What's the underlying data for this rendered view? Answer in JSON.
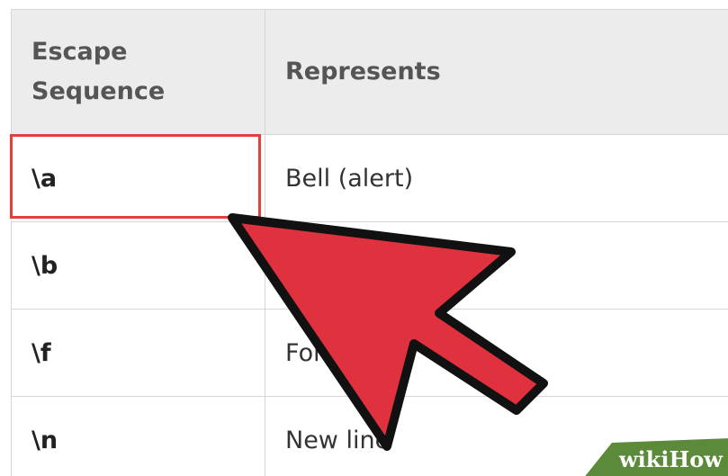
{
  "table": {
    "headers": [
      "Escape Sequence",
      "Represents"
    ],
    "rows": [
      {
        "sequence": "\\a",
        "represents": "Bell (alert)"
      },
      {
        "sequence": "\\b",
        "represents": ""
      },
      {
        "sequence": "\\f",
        "represents": "For"
      },
      {
        "sequence": "\\n",
        "represents": "New line"
      }
    ]
  },
  "highlight": {
    "target": "\\a",
    "color": "#e0413e"
  },
  "pointer": {
    "icon": "arrow-pointer-icon",
    "color": "#e0313f"
  },
  "watermark": {
    "text": "wikiHow",
    "color": "#5a8a3a"
  }
}
